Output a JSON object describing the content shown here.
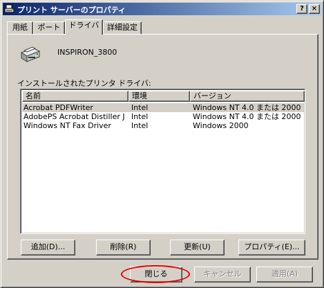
{
  "window": {
    "title": "プリント サーバーのプロパティ",
    "help_label": "?",
    "close_label": "×"
  },
  "tabs": [
    {
      "label": "用紙"
    },
    {
      "label": "ポート"
    },
    {
      "label": "ドライバ",
      "active": true
    },
    {
      "label": "詳細設定"
    }
  ],
  "server": {
    "name": "INSPIRON_3800"
  },
  "drivers_section": {
    "label": "インストールされたプリンタ ドライバ:",
    "columns": [
      "名前",
      "環境",
      "バージョン"
    ],
    "rows": [
      {
        "name": "Acrobat PDFWriter",
        "env": "Intel",
        "version": "Windows NT 4.0 または 2000",
        "selected": true
      },
      {
        "name": "AdobePS Acrobat Distiller J",
        "env": "Intel",
        "version": "Windows NT 4.0 または 2000"
      },
      {
        "name": "Windows NT Fax Driver",
        "env": "Intel",
        "version": "Windows 2000"
      }
    ]
  },
  "buttons": {
    "add": "追加(D)...",
    "remove": "削除(R)",
    "update": "更新(U)",
    "properties": "プロパティ(E)..."
  },
  "footer": {
    "close": "閉じる",
    "cancel": "キャンセル",
    "apply": "適用(A)"
  },
  "colors": {
    "face": "#d4d0c8",
    "title_start": "#0a246a",
    "title_end": "#a6caf0",
    "highlight": "#e00000"
  }
}
